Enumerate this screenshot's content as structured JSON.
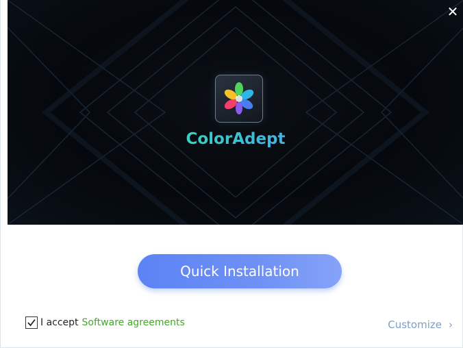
{
  "window": {
    "close_glyph": "✕"
  },
  "hero": {
    "app_name": "ColorAdept",
    "logo_icon": "color-petals-icon"
  },
  "actions": {
    "install_label": "Quick Installation",
    "accept_label": "I accept",
    "agreements_link": "Software agreements",
    "accept_checked": true,
    "customize_label": "Customize",
    "customize_chevron": "›"
  },
  "colors": {
    "hero_bg": "#06090d",
    "install_button": "#6a8df5",
    "link_green": "#43a827",
    "customize_blue": "#7e9ec4"
  }
}
